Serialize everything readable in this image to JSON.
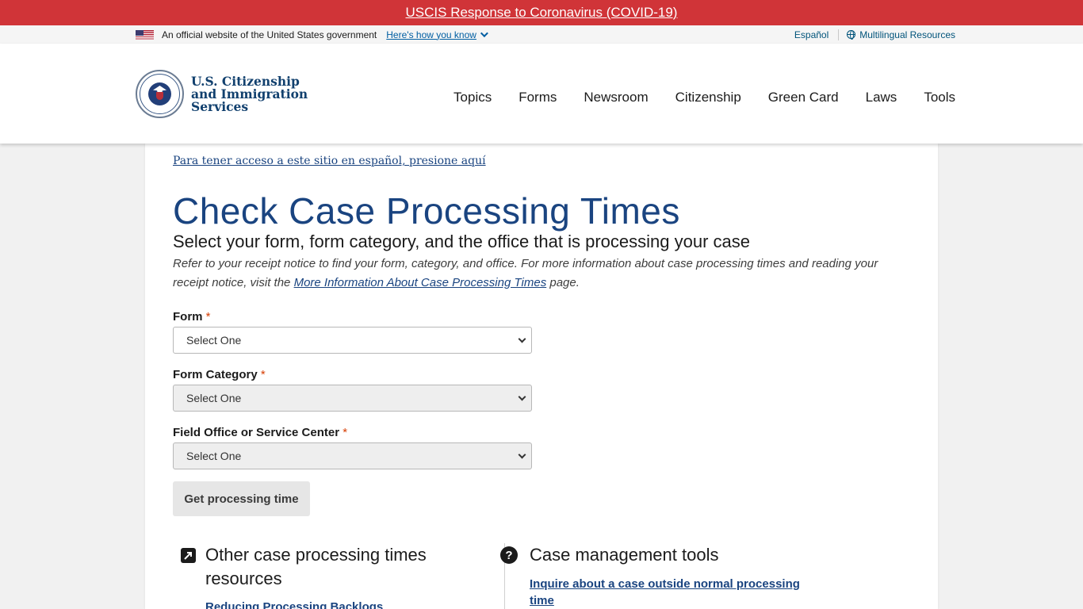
{
  "alert": {
    "text": "USCIS Response to Coronavirus (COVID-19)"
  },
  "gov_banner": {
    "text": "An official website of the United States government",
    "how_link": "Here's how you know",
    "espanol": "Español",
    "multilingual": "Multilingual Resources"
  },
  "header": {
    "logo_line1": "U.S. Citizenship",
    "logo_line2": "and Immigration",
    "logo_line3": "Services",
    "nav": [
      "Topics",
      "Forms",
      "Newsroom",
      "Citizenship",
      "Green Card",
      "Laws",
      "Tools"
    ]
  },
  "main": {
    "spanish_link": "Para tener acceso a este sitio en español, presione aquí",
    "title": "Check Case Processing Times",
    "subtitle": "Select your form, form category, and the office that is processing your case",
    "intro_before": "Refer to your receipt notice to find your form, category, and office. For more information about case processing times and reading your receipt notice, visit the ",
    "intro_link": "More Information About Case Processing Times",
    "intro_after": " page.",
    "form": {
      "form_label": "Form",
      "form_value": "Select One",
      "category_label": "Form Category",
      "category_value": "Select One",
      "office_label": "Field Office or Service Center",
      "office_value": "Select One",
      "required_mark": "*",
      "submit_label": "Get processing time"
    },
    "resources": {
      "title": "Other case processing times resources",
      "link": "Reducing Processing Backlogs"
    },
    "tools": {
      "icon_glyph": "?",
      "title": "Case management tools",
      "link": "Inquire about a case outside normal processing time"
    }
  },
  "colors": {
    "alert_bg": "#d03438",
    "title_blue": "#1a4480",
    "link_blue": "#005ea2",
    "required_red": "#d63e04"
  },
  "icons": [
    "us-flag-icon",
    "chevron-down-icon",
    "globe-icon",
    "dhs-seal-icon",
    "external-link-icon",
    "question-icon"
  ]
}
